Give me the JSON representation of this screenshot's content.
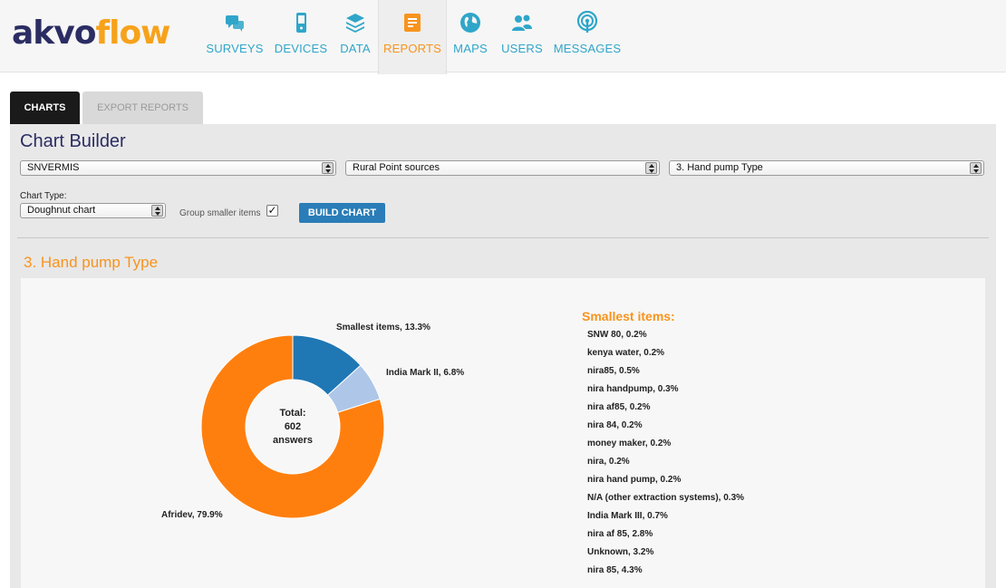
{
  "logo": {
    "part1": "akvo",
    "part2": "flow"
  },
  "nav": [
    {
      "label": "SURVEYS",
      "icon": "chat-bubbles-icon"
    },
    {
      "label": "DEVICES",
      "icon": "phone-icon"
    },
    {
      "label": "DATA",
      "icon": "layers-icon"
    },
    {
      "label": "REPORTS",
      "icon": "notebook-icon",
      "active": true
    },
    {
      "label": "MAPS",
      "icon": "globe-icon"
    },
    {
      "label": "USERS",
      "icon": "users-icon"
    },
    {
      "label": "MESSAGES",
      "icon": "broadcast-icon"
    }
  ],
  "tabs": {
    "charts": "CHARTS",
    "export": "EXPORT REPORTS"
  },
  "builder": {
    "title": "Chart Builder",
    "survey_group": "SNVERMIS",
    "survey": "Rural Point sources",
    "question": "3. Hand pump Type",
    "chart_type_label": "Chart Type:",
    "chart_type": "Doughnut chart",
    "group_label": "Group smaller items",
    "group_checked": "✓",
    "build_button": "BUILD CHART"
  },
  "question_title": "3. Hand pump Type",
  "center": {
    "line1": "Total:",
    "line2": "602",
    "line3": "answers"
  },
  "chart_data": {
    "type": "pie",
    "variant": "doughnut",
    "total_answers": 602,
    "slices": [
      {
        "label": "Smallest items, 13.3%",
        "value": 13.3,
        "color": "#1f77b4"
      },
      {
        "label": "India Mark II, 6.8%",
        "value": 6.8,
        "color": "#aec7e8"
      },
      {
        "label": "Afridev, 79.9%",
        "value": 79.9,
        "color": "#ff7f0e"
      }
    ]
  },
  "smallest": {
    "title": "Smallest items:",
    "items": [
      "SNW 80, 0.2%",
      "kenya water, 0.2%",
      "nira85, 0.5%",
      "nira handpump, 0.3%",
      "nira af85, 0.2%",
      "nira 84, 0.2%",
      "money maker, 0.2%",
      "nira, 0.2%",
      "nira hand pump, 0.2%",
      "N/A (other extraction systems), 0.3%",
      "India Mark III, 0.7%",
      "nira af 85, 2.8%",
      "Unknown, 3.2%",
      "nira 85, 4.3%"
    ]
  }
}
